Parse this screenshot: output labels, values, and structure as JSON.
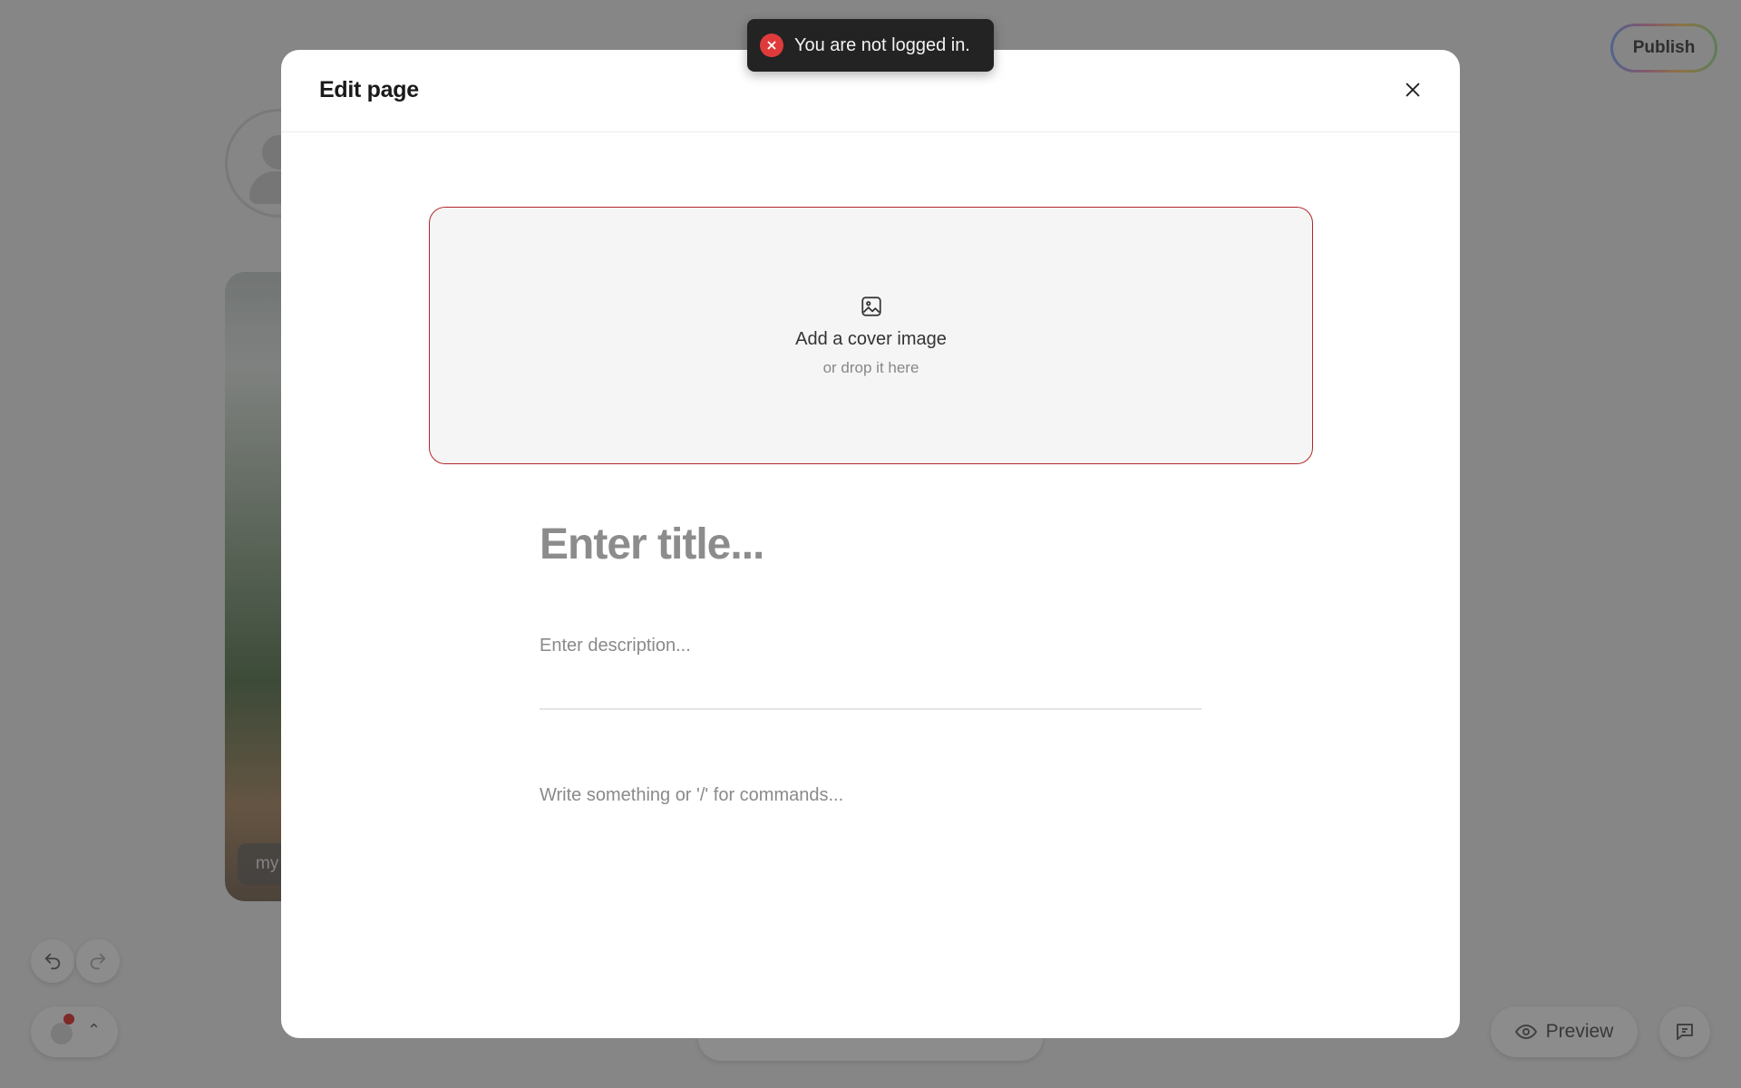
{
  "background": {
    "publish_label": "Publish",
    "photo_caption": "my",
    "preview_label": "Preview"
  },
  "modal": {
    "title": "Edit page",
    "cover": {
      "title": "Add a cover image",
      "subtitle": "or drop it here"
    },
    "title_placeholder": "Enter title...",
    "description_placeholder": "Enter description...",
    "body_placeholder": "Write something or '/' for commands..."
  },
  "toast": {
    "message": "You are not logged in.",
    "type": "error"
  },
  "colors": {
    "error": "#e03b3b",
    "cover_border": "#b3262b"
  }
}
